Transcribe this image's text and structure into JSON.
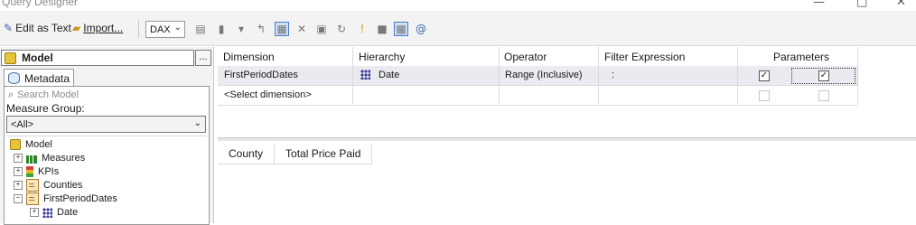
{
  "window": {
    "title": "Query Designer"
  },
  "toolbar": {
    "edit_as_text": "Edit as Text",
    "import": "Import...",
    "query_language": "DAX"
  },
  "left": {
    "cube_selector": "Model",
    "ellipsis": "...",
    "metadata_tab": "Metadata",
    "search_placeholder": "Search Model",
    "measure_group_label": "Measure Group:",
    "measure_group_value": "<All>",
    "tree": [
      {
        "label": "Model",
        "icon": "model-cube-icon",
        "level": 0,
        "expander": ""
      },
      {
        "label": "Measures",
        "icon": "measures-icon",
        "level": 1,
        "expander": "+"
      },
      {
        "label": "KPIs",
        "icon": "kpis-icon",
        "level": 1,
        "expander": "+"
      },
      {
        "label": "Counties",
        "icon": "table-icon",
        "level": 1,
        "expander": "+"
      },
      {
        "label": "FirstPeriodDates",
        "icon": "table-icon",
        "level": 1,
        "expander": "−"
      },
      {
        "label": "Date",
        "icon": "hierarchy-icon",
        "level": 2,
        "expander": "+"
      }
    ]
  },
  "filter_grid": {
    "columns": [
      "Dimension",
      "Hierarchy",
      "Operator",
      "Filter Expression",
      "Parameters"
    ],
    "rows": [
      {
        "dimension": "FirstPeriodDates",
        "hierarchy": "Date",
        "operator": "Range (Inclusive)",
        "filter_expression": ":",
        "param_from": true,
        "param_to": true
      },
      {
        "dimension": "<Select dimension>",
        "hierarchy": "",
        "operator": "",
        "filter_expression": "",
        "param_from": false,
        "param_to": false
      }
    ]
  },
  "results": {
    "columns": [
      "County",
      "Total Price Paid"
    ]
  },
  "colors": {
    "toolbar_bg": "#f3f3f3",
    "selected_row_bg": "#eaeaf1",
    "accent_blue": "#4a7cc7",
    "cube_yellow": "#e8c43a"
  }
}
